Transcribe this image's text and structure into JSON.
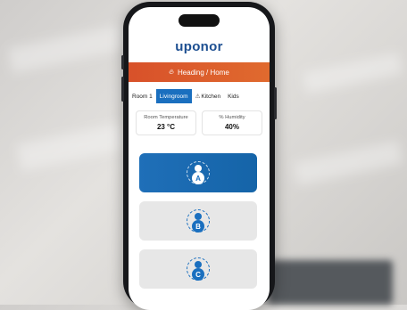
{
  "app": {
    "brand": "uponor"
  },
  "header": {
    "title": "Heading / Home",
    "icon": "flame-icon"
  },
  "tabs": [
    {
      "label": "Room 1",
      "active": false
    },
    {
      "label": "Livingroom",
      "active": true
    },
    {
      "label": "Kitchen",
      "active": false,
      "warning": true
    },
    {
      "label": "Kids",
      "active": false
    }
  ],
  "readings": {
    "temperature": {
      "label": "Room Temperature",
      "value": "23 °C"
    },
    "humidity": {
      "label": "% Humidity",
      "value": "40%"
    }
  },
  "zones": [
    {
      "letter": "A",
      "active": true
    },
    {
      "letter": "B",
      "active": false
    },
    {
      "letter": "C",
      "active": false
    }
  ],
  "colors": {
    "accent": "#1a6fbf",
    "header": "#d8512a",
    "brand": "#1d4f91"
  }
}
